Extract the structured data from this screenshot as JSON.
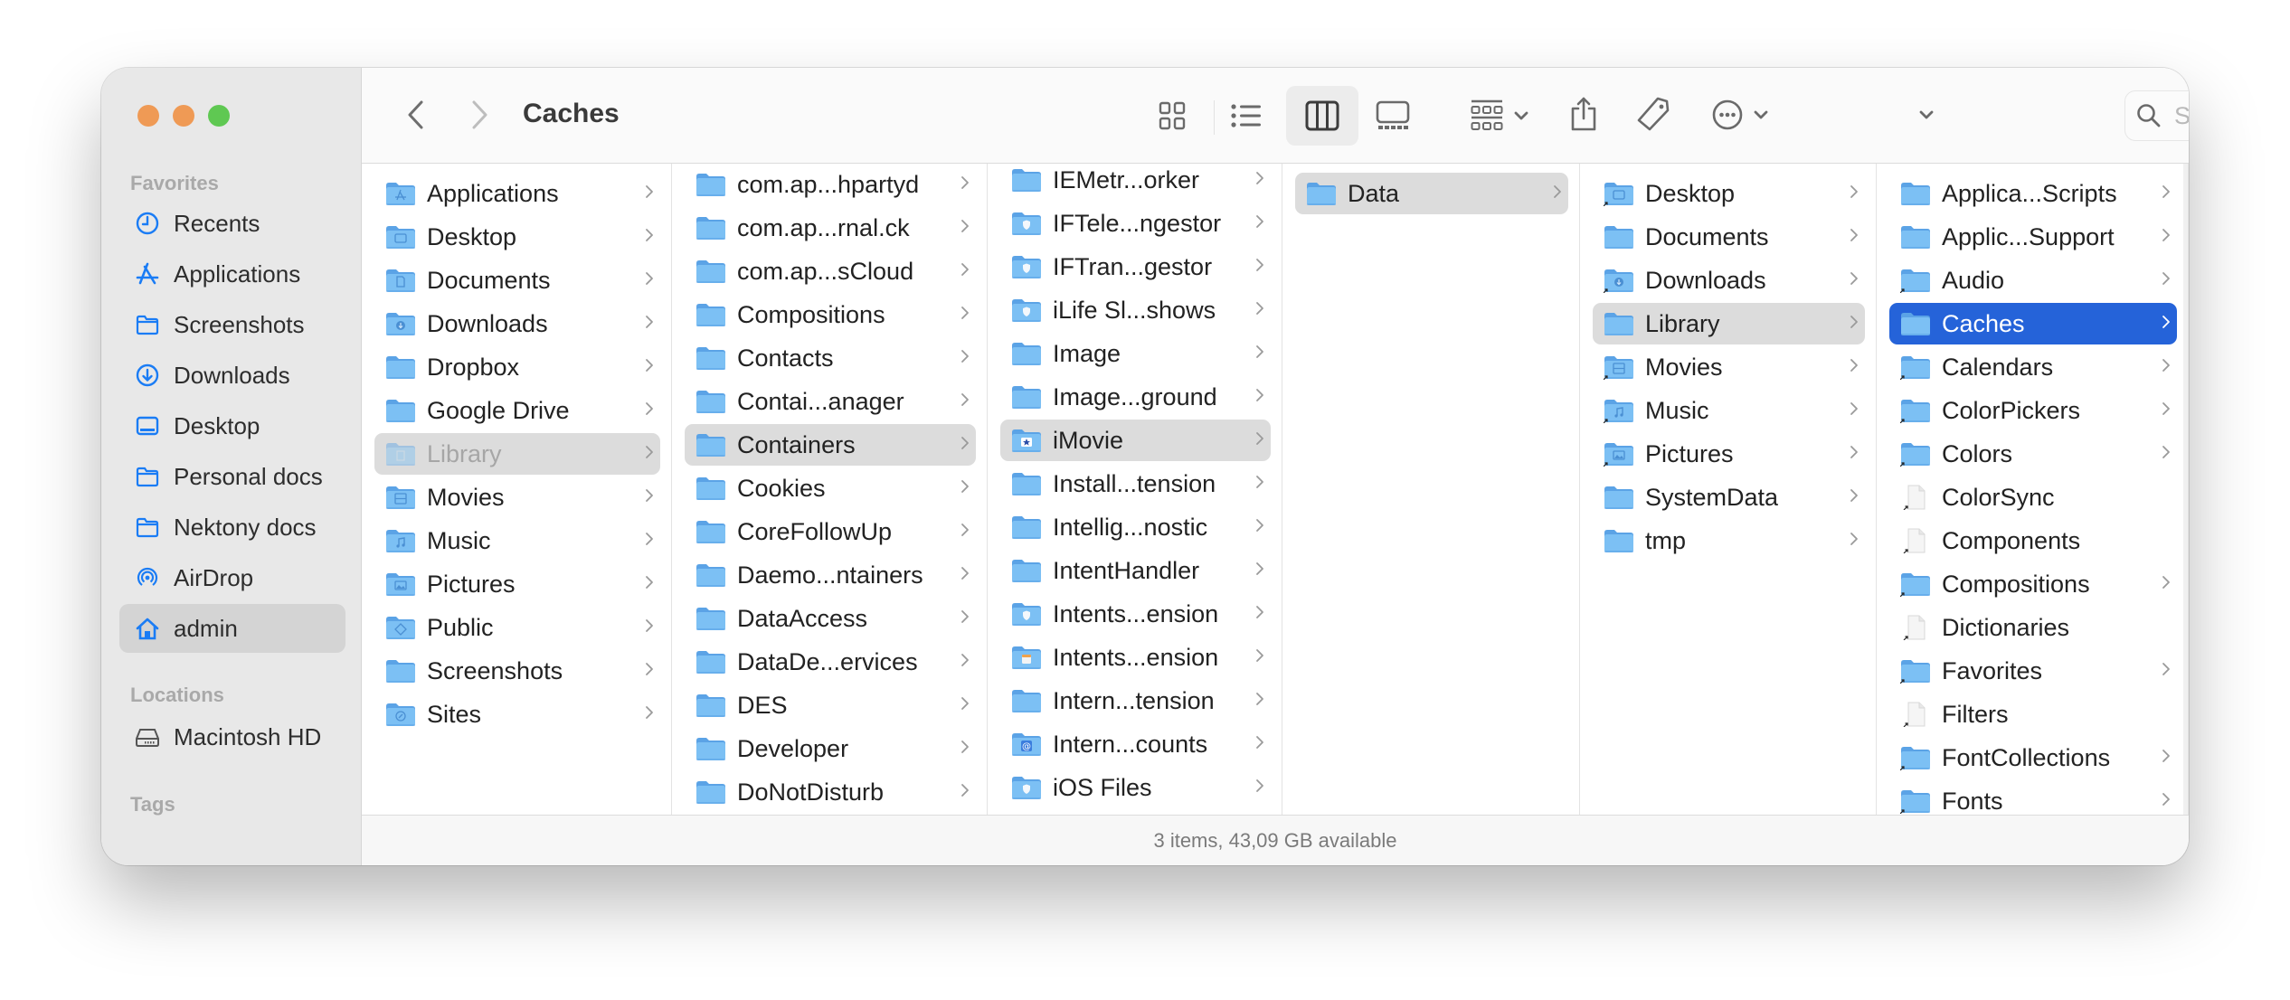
{
  "window": {
    "title": "Caches",
    "traffic_lights": [
      "#ef9a55",
      "#ef9a55",
      "#5fc852"
    ]
  },
  "sidebar": {
    "favorites_heading": "Favorites",
    "favorites": [
      {
        "label": "Recents",
        "icon": "clock-icon"
      },
      {
        "label": "Applications",
        "icon": "app-store-icon"
      },
      {
        "label": "Screenshots",
        "icon": "folder-icon"
      },
      {
        "label": "Downloads",
        "icon": "download-circle-icon"
      },
      {
        "label": "Desktop",
        "icon": "desktop-icon"
      },
      {
        "label": "Personal docs",
        "icon": "folder-icon"
      },
      {
        "label": "Nektony docs",
        "icon": "folder-icon"
      },
      {
        "label": "AirDrop",
        "icon": "airdrop-icon"
      },
      {
        "label": "admin",
        "icon": "home-icon",
        "selected": true
      }
    ],
    "locations_heading": "Locations",
    "locations": [
      {
        "label": "Macintosh HD",
        "icon": "disk-icon"
      }
    ],
    "tags_heading": "Tags",
    "accent_color": "#1a7cf5"
  },
  "toolbar": {
    "back": "back-icon",
    "forward": "forward-icon",
    "views": [
      "icon-view",
      "list-view",
      "column-view",
      "gallery-view"
    ],
    "active_view": "column-view",
    "search_placeholder": "Search",
    "search_value": ""
  },
  "columns": [
    {
      "items": [
        {
          "name": "Applications",
          "badge": "apps",
          "folder": true
        },
        {
          "name": "Desktop",
          "badge": "desktop",
          "folder": true
        },
        {
          "name": "Documents",
          "badge": "doc",
          "folder": true
        },
        {
          "name": "Downloads",
          "badge": "download",
          "folder": true
        },
        {
          "name": "Dropbox",
          "badge": "",
          "folder": true
        },
        {
          "name": "Google Drive",
          "badge": "",
          "folder": true
        },
        {
          "name": "Library",
          "badge": "library",
          "folder": true,
          "state": "path-dim"
        },
        {
          "name": "Movies",
          "badge": "movie",
          "folder": true
        },
        {
          "name": "Music",
          "badge": "music",
          "folder": true
        },
        {
          "name": "Pictures",
          "badge": "picture",
          "folder": true
        },
        {
          "name": "Public",
          "badge": "public",
          "folder": true
        },
        {
          "name": "Screenshots",
          "badge": "",
          "folder": true
        },
        {
          "name": "Sites",
          "badge": "compass",
          "folder": true
        }
      ]
    },
    {
      "items": [
        {
          "name": "com.ap...hpartyd",
          "folder": true
        },
        {
          "name": "com.ap...rnal.ck",
          "folder": true
        },
        {
          "name": "com.ap...sCloud",
          "folder": true
        },
        {
          "name": "Compositions",
          "folder": true
        },
        {
          "name": "Contacts",
          "folder": true
        },
        {
          "name": "Contai...anager",
          "folder": true
        },
        {
          "name": "Containers",
          "folder": true,
          "state": "path"
        },
        {
          "name": "Cookies",
          "folder": true
        },
        {
          "name": "CoreFollowUp",
          "folder": true
        },
        {
          "name": "Daemo...ntainers",
          "folder": true
        },
        {
          "name": "DataAccess",
          "folder": true
        },
        {
          "name": "DataDe...ervices",
          "folder": true
        },
        {
          "name": "DES",
          "folder": true
        },
        {
          "name": "Developer",
          "folder": true
        },
        {
          "name": "DoNotDisturb",
          "folder": true
        }
      ]
    },
    {
      "items": [
        {
          "name": "IEMetr...orker",
          "folder": true
        },
        {
          "name": "IFTele...ngestor",
          "folder": true,
          "badge": "shield"
        },
        {
          "name": "IFTran...gestor",
          "folder": true,
          "badge": "shield"
        },
        {
          "name": "iLife Sl...shows",
          "folder": true,
          "badge": "shield"
        },
        {
          "name": "Image",
          "folder": true
        },
        {
          "name": "Image...ground",
          "folder": true
        },
        {
          "name": "iMovie",
          "folder": true,
          "badge": "star",
          "state": "path"
        },
        {
          "name": "Install...tension",
          "folder": true
        },
        {
          "name": "Intellig...nostic",
          "folder": true
        },
        {
          "name": "IntentHandler",
          "folder": true
        },
        {
          "name": "Intents...ension",
          "folder": true,
          "badge": "shield"
        },
        {
          "name": "Intents...ension",
          "folder": true,
          "badge": "notes"
        },
        {
          "name": "Intern...tension",
          "folder": true
        },
        {
          "name": "Intern...counts",
          "folder": true,
          "badge": "at"
        },
        {
          "name": "iOS Files",
          "folder": true,
          "badge": "shield"
        }
      ]
    },
    {
      "items": [
        {
          "name": "Data",
          "folder": true,
          "state": "path"
        }
      ]
    },
    {
      "items": [
        {
          "name": "Desktop",
          "folder": true,
          "badge": "desktop",
          "alias": true
        },
        {
          "name": "Documents",
          "folder": true
        },
        {
          "name": "Downloads",
          "folder": true,
          "badge": "download",
          "alias": true
        },
        {
          "name": "Library",
          "folder": true,
          "state": "path"
        },
        {
          "name": "Movies",
          "folder": true,
          "badge": "movie",
          "alias": true
        },
        {
          "name": "Music",
          "folder": true,
          "badge": "music",
          "alias": true
        },
        {
          "name": "Pictures",
          "folder": true,
          "badge": "picture",
          "alias": true
        },
        {
          "name": "SystemData",
          "folder": true
        },
        {
          "name": "tmp",
          "folder": true
        }
      ]
    },
    {
      "items": [
        {
          "name": "Applica...Scripts",
          "folder": true
        },
        {
          "name": "Applic...Support",
          "folder": true
        },
        {
          "name": "Audio",
          "folder": true,
          "alias": true
        },
        {
          "name": "Caches",
          "folder": true,
          "state": "selected"
        },
        {
          "name": "Calendars",
          "folder": true,
          "alias": true
        },
        {
          "name": "ColorPickers",
          "folder": true,
          "alias": true
        },
        {
          "name": "Colors",
          "folder": true,
          "alias": true
        },
        {
          "name": "ColorSync",
          "folder": false,
          "alias": true
        },
        {
          "name": "Components",
          "folder": false,
          "alias": true
        },
        {
          "name": "Compositions",
          "folder": true,
          "alias": true
        },
        {
          "name": "Dictionaries",
          "folder": false,
          "alias": true
        },
        {
          "name": "Favorites",
          "folder": true,
          "alias": true
        },
        {
          "name": "Filters",
          "folder": false,
          "alias": true
        },
        {
          "name": "FontCollections",
          "folder": true,
          "alias": true
        },
        {
          "name": "Fonts",
          "folder": true,
          "alias": true
        }
      ]
    }
  ],
  "statusbar": {
    "text": "3 items, 43,09 GB available"
  },
  "colors": {
    "selection": "#2563d9",
    "folder": "#7cc0f4",
    "folder_tab": "#5ba3e6"
  }
}
